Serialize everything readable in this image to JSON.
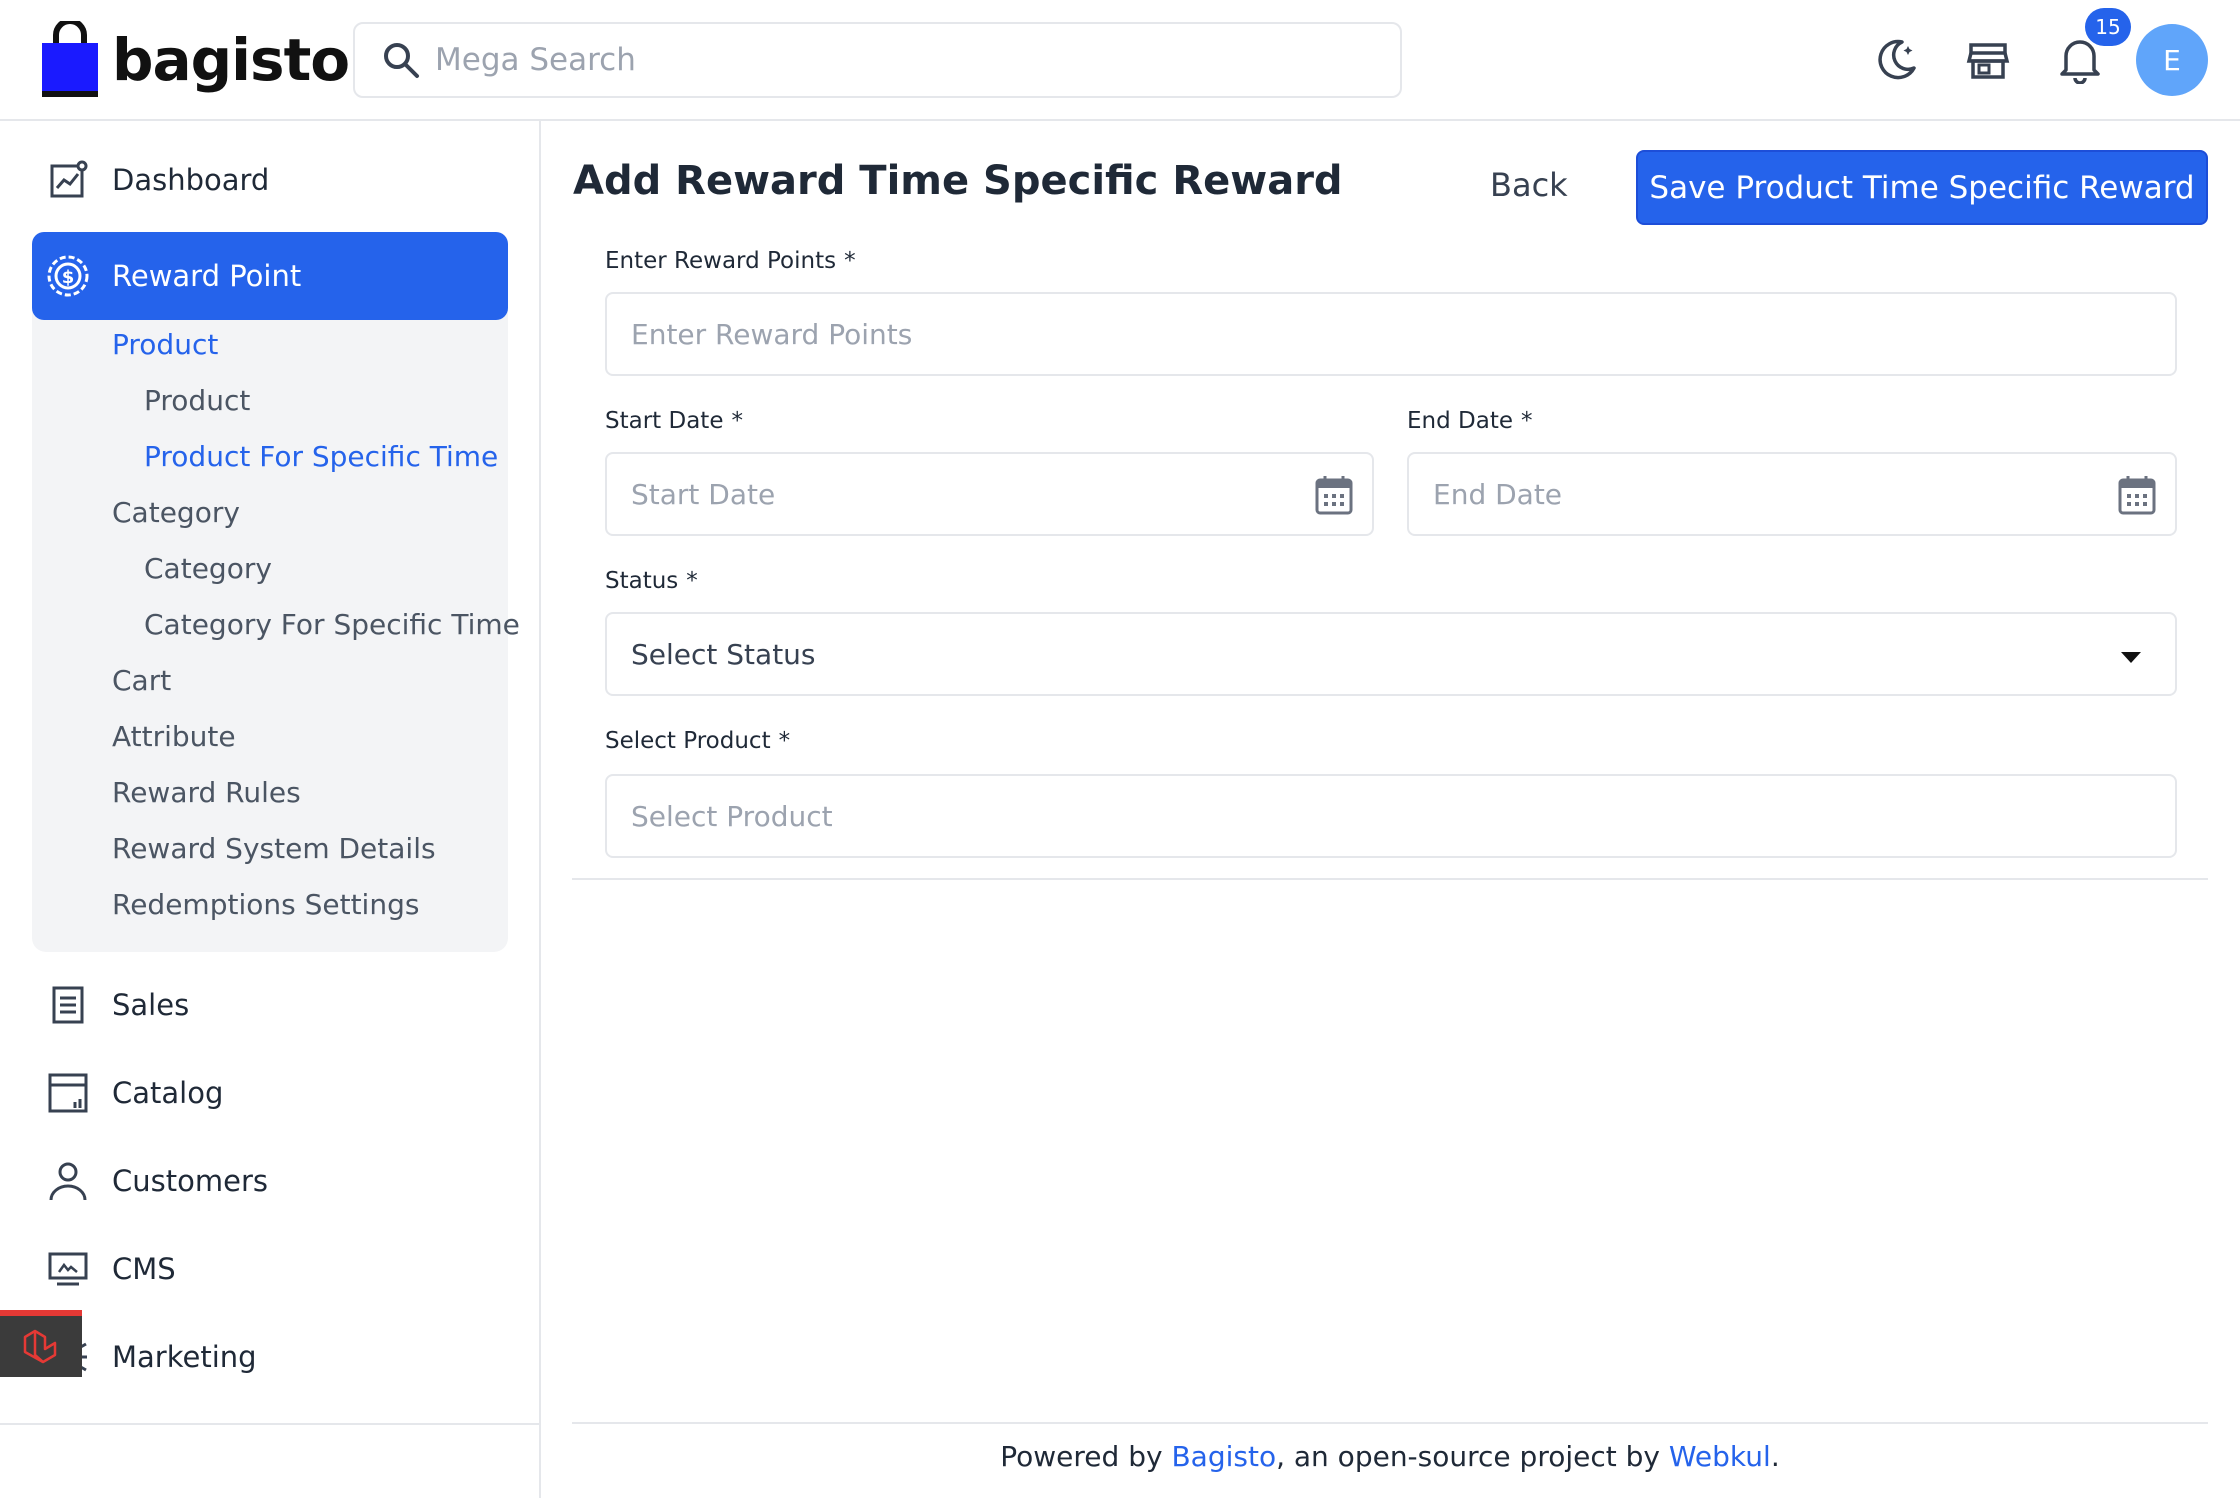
{
  "header": {
    "brand": "bagisto",
    "search_placeholder": "Mega Search",
    "notifications_count": "15",
    "avatar_initial": "E"
  },
  "sidebar": {
    "dashboard": "Dashboard",
    "reward_point": "Reward Point",
    "sub": {
      "product": "Product",
      "product_item": "Product",
      "product_specific_time": "Product For Specific Time",
      "category": "Category",
      "category_item": "Category",
      "category_specific_time": "Category For Specific Time",
      "cart": "Cart",
      "attribute": "Attribute",
      "reward_rules": "Reward Rules",
      "reward_system_details": "Reward System Details",
      "redemptions_settings": "Redemptions Settings"
    },
    "sales": "Sales",
    "catalog": "Catalog",
    "customers": "Customers",
    "cms": "CMS",
    "marketing": "Marketing"
  },
  "main": {
    "title": "Add Reward Time Specific Reward",
    "back_label": "Back",
    "save_label": "Save Product Time Specific Reward",
    "form": {
      "reward_points_label": "Enter Reward Points",
      "reward_points_placeholder": "Enter Reward Points",
      "start_date_label": "Start Date",
      "start_date_placeholder": "Start Date",
      "end_date_label": "End Date",
      "end_date_placeholder": "End Date",
      "status_label": "Status",
      "status_value": "Select Status",
      "select_product_label": "Select Product",
      "select_product_placeholder": "Select Product",
      "required_mark": "*"
    }
  },
  "footer": {
    "prefix": "Powered by ",
    "bagisto_link": "Bagisto",
    "middle": ", an open-source project by ",
    "webkul_link": "Webkul",
    "suffix": "."
  },
  "colors": {
    "accent": "#2563eb",
    "avatar": "#60a5fa"
  }
}
